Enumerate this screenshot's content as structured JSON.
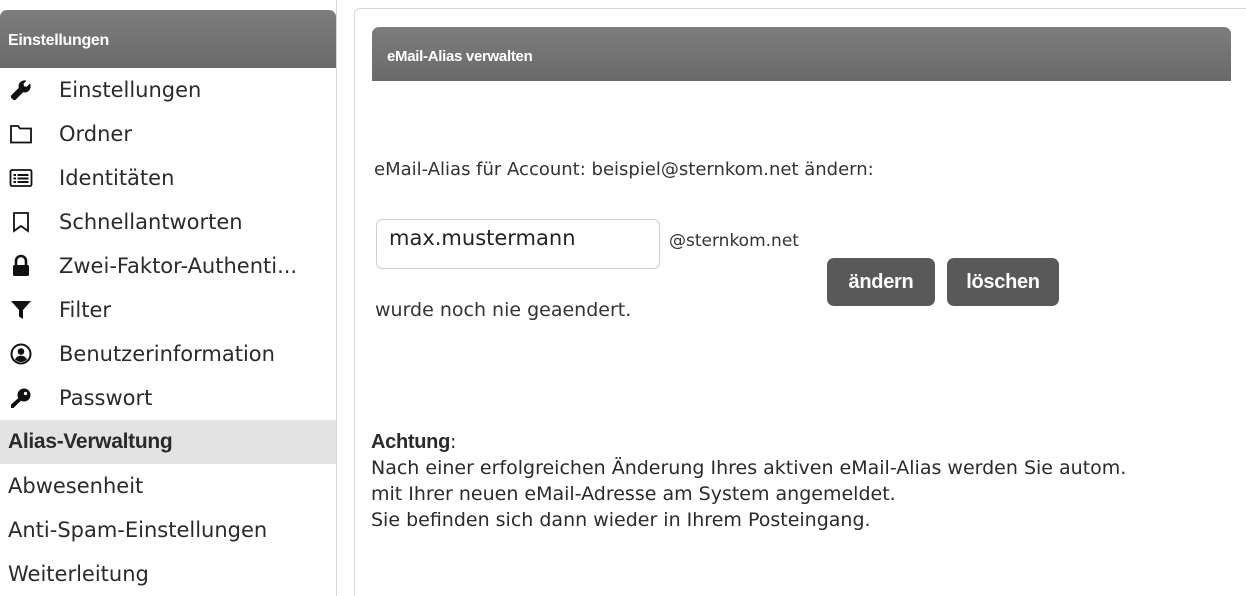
{
  "sidebar": {
    "header": "Einstellungen",
    "items": [
      {
        "label": "Einstellungen",
        "icon": "wrench-icon"
      },
      {
        "label": "Ordner",
        "icon": "folder-icon"
      },
      {
        "label": "Identitäten",
        "icon": "id-card-icon"
      },
      {
        "label": "Schnellantworten",
        "icon": "bookmark-icon"
      },
      {
        "label": "Zwei-Faktor-Authenti...",
        "icon": "lock-icon"
      },
      {
        "label": "Filter",
        "icon": "filter-icon"
      },
      {
        "label": "Benutzerinformation",
        "icon": "user-circle-icon"
      },
      {
        "label": "Passwort",
        "icon": "key-icon"
      },
      {
        "label": "Alias-Verwaltung",
        "active": true
      },
      {
        "label": "Abwesenheit"
      },
      {
        "label": "Anti-Spam-Einstellungen"
      },
      {
        "label": "Weiterleitung"
      }
    ]
  },
  "main": {
    "title": "eMail-Alias verwalten",
    "account_line": "eMail-Alias für Account: beispiel@sternkom.net ändern:",
    "alias_value": "max.mustermann",
    "domain_suffix": "@sternkom.net",
    "change_button": "ändern",
    "delete_button": "löschen",
    "status_text": "wurde noch nie geaendert.",
    "notice": {
      "title": "Achtung",
      "colon": ":",
      "lines": [
        "Nach einer erfolgreichen Änderung Ihres aktiven eMail-Alias werden Sie autom.",
        "mit Ihrer neuen eMail-Adresse am System angemeldet.",
        "Sie befinden sich dann wieder in Ihrem Posteingang."
      ]
    }
  },
  "colors": {
    "header_bg": "#737373",
    "button_bg": "#595959",
    "active_item_bg": "#e3e3e3"
  }
}
